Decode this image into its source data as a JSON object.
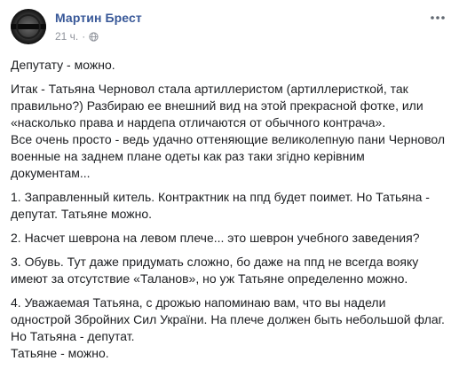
{
  "post": {
    "author": "Мартин Брест",
    "time": "21 ч.",
    "separator": "·",
    "paragraphs": [
      "Депутату - можно.",
      "Итак - Татьяна Черновол стала артиллеристом (артиллеристкой, так\nправильно?) Разбираю ее внешний вид на этой прекрасной фотке, или\n«насколько права и нардепа отличаются от обычного контрача».\nВсе очень просто - ведь удачно оттеняющие великолепную пани Черновол\nвоенные на заднем плане одеты как раз таки згідно керівним\nдокументам...",
      "1. Заправленный китель. Контрактник на ппд будет поимет. Но Татьяна -\nдепутат. Татьяне можно.",
      "2. Насчет шеврона на левом плече... это шеврон учебного заведения?",
      "3. Обувь. Тут даже придумать сложно, бо даже на ппд не всегда вояку\nимеют за отсутствие «Таланов», но уж Татьяне определенно можно.",
      "4. Уважаемая Татьяна, с дрожью напоминаю вам, что вы надели\nоднострой Збройних Сил України. На плече должен быть небольшой флаг.\nНо Татьяна - депутат.\nТатьяне - можно."
    ]
  },
  "icons": {
    "privacy": "globe-icon",
    "menu": "more-icon"
  },
  "colors": {
    "author": "#385898",
    "meta": "#90949c",
    "text": "#1c1e21"
  }
}
